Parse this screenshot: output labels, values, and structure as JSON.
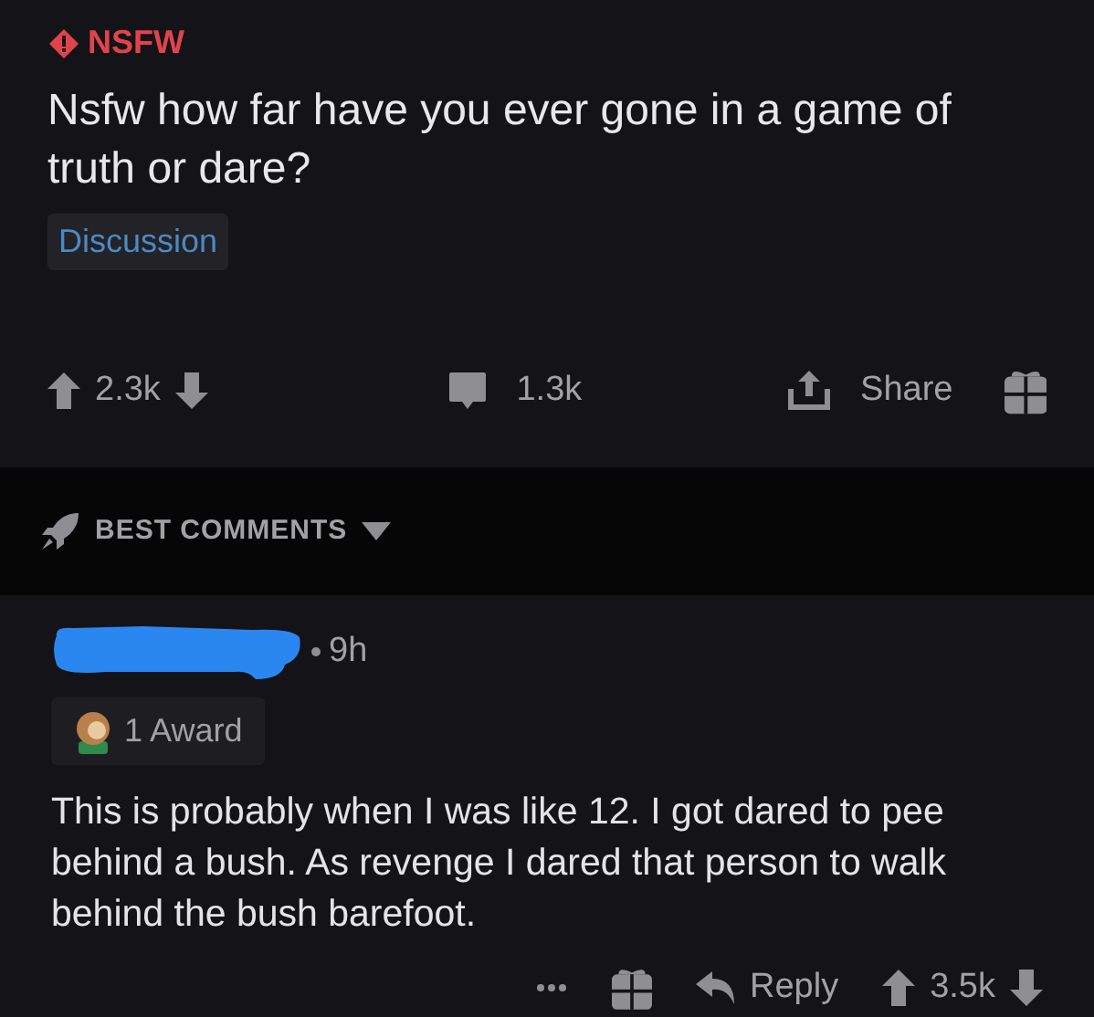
{
  "post": {
    "flair": "NSFW",
    "title": "Nsfw how far have you ever gone in a game of truth or dare?",
    "tag": "Discussion",
    "votes": "2.3k",
    "comments": "1.3k",
    "share": "Share"
  },
  "sort": {
    "label": "BEST COMMENTS"
  },
  "comment": {
    "age": "9h",
    "award": "1 Award",
    "body": "This is probably when I was like 12. I got dared to pee behind a bush. As revenge I dared that person to walk behind the bush barefoot.",
    "reply": "Reply",
    "votes": "3.5k"
  }
}
